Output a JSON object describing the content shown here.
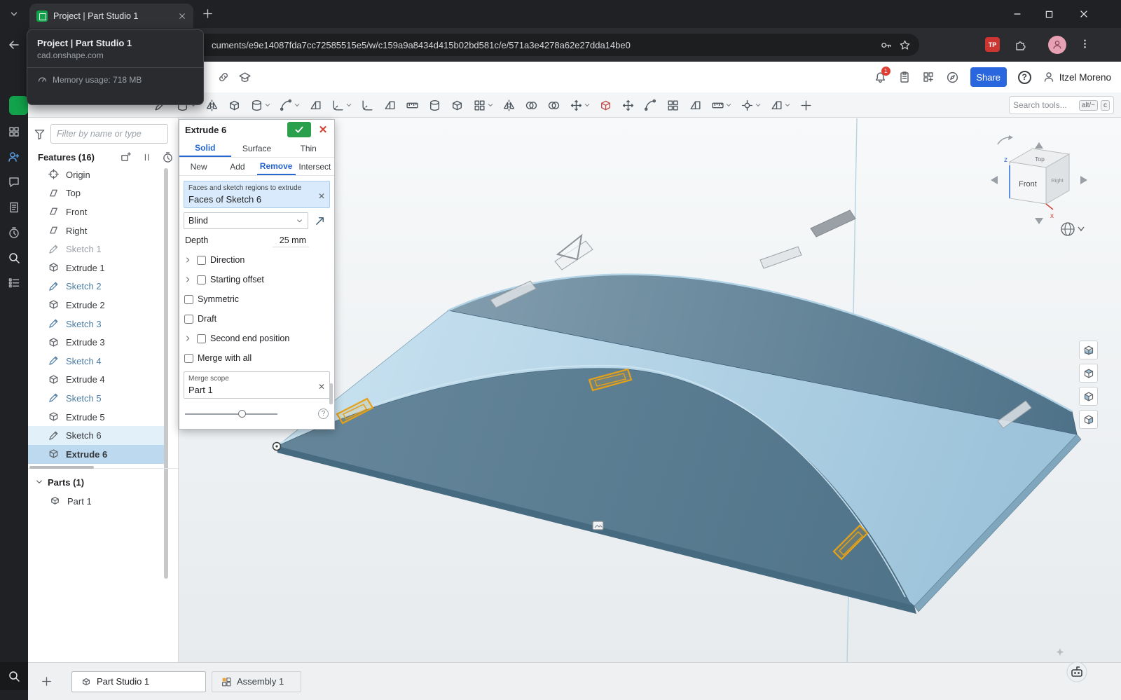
{
  "browser": {
    "tab_title": "Project | Part Studio 1",
    "url": "cuments/e9e14087fda7cc72585515e5/w/c159a9a8434d415b02bd581c/e/571a3e4278a62e27dda14be0",
    "tp_badge": "TP",
    "hovercard": {
      "title": "Project | Part Studio 1",
      "domain": "cad.onshape.com",
      "memory_label": "Memory usage: 718 MB"
    }
  },
  "rail": {
    "icons": [
      {
        "name": "apps-grid-icon",
        "glyph": "grid",
        "color": "#a9adb2"
      },
      {
        "name": "add-person-icon",
        "glyph": "personadd",
        "color": "#5aa2e8"
      },
      {
        "name": "chat-icon",
        "glyph": "chat",
        "color": "#a9adb2"
      },
      {
        "name": "notes-icon",
        "glyph": "note",
        "color": "#a9adb2"
      },
      {
        "name": "history-icon",
        "glyph": "clock",
        "color": "#a9adb2"
      },
      {
        "name": "search-icon",
        "glyph": "search",
        "color": "#e4e6e8"
      },
      {
        "name": "tasks-icon",
        "glyph": "tasks",
        "color": "#a9adb2"
      }
    ]
  },
  "header": {
    "notification_count": "1",
    "share_label": "Share",
    "help_label": "?",
    "user_name": "Itzel Moreno"
  },
  "toolbar": {
    "search_placeholder": "Search tools...",
    "shortcut_keys": [
      "alt/~",
      "c"
    ],
    "tools": [
      {
        "name": "sketch-icon",
        "glyph": "pen",
        "dropdown": false
      },
      {
        "name": "circle-icon",
        "glyph": "cyl",
        "dropdown": true
      },
      {
        "name": "mirror-sketch-icon",
        "glyph": "mir",
        "dropdown": false
      },
      {
        "name": "extrude-icon",
        "glyph": "box",
        "dropdown": false
      },
      {
        "name": "revolve-icon",
        "glyph": "cyl",
        "dropdown": true
      },
      {
        "name": "sweep-icon",
        "glyph": "arc",
        "dropdown": true
      },
      {
        "name": "loft-icon",
        "glyph": "she",
        "dropdown": false
      },
      {
        "name": "fillet-icon",
        "glyph": "fil",
        "dropdown": true
      },
      {
        "name": "chamfer-icon",
        "glyph": "fil",
        "dropdown": false
      },
      {
        "name": "draft-icon",
        "glyph": "she",
        "dropdown": false
      },
      {
        "name": "rib-icon",
        "glyph": "rul",
        "dropdown": false
      },
      {
        "name": "hole-icon",
        "glyph": "cyl",
        "dropdown": false
      },
      {
        "name": "shell-icon",
        "glyph": "box",
        "dropdown": false
      },
      {
        "name": "linear-pattern-icon",
        "glyph": "grid",
        "dropdown": true
      },
      {
        "name": "mirror-pattern-icon",
        "glyph": "mir",
        "dropdown": false
      },
      {
        "name": "boolean-icon",
        "glyph": "ven",
        "dropdown": false
      },
      {
        "name": "split-icon",
        "glyph": "ven",
        "dropdown": false
      },
      {
        "name": "transform-icon",
        "glyph": "mov",
        "dropdown": true
      },
      {
        "name": "delete-face-icon",
        "glyph": "box",
        "dropdown": false
      },
      {
        "name": "move-face-icon",
        "glyph": "mov",
        "dropdown": false
      },
      {
        "name": "offset-surface-icon",
        "glyph": "arc",
        "dropdown": false
      },
      {
        "name": "boundary-surface-icon",
        "glyph": "grid",
        "dropdown": false
      },
      {
        "name": "fill-surface-icon",
        "glyph": "she",
        "dropdown": false
      },
      {
        "name": "measure-icon",
        "glyph": "rul",
        "dropdown": true
      },
      {
        "name": "mate-connector-icon",
        "glyph": "con",
        "dropdown": true
      },
      {
        "name": "sheet-metal-icon",
        "glyph": "she",
        "dropdown": true
      },
      {
        "name": "custom-feature-icon",
        "glyph": "plu",
        "dropdown": false
      }
    ]
  },
  "sidebar": {
    "filter_placeholder": "Filter by name or type",
    "features_header": "Features (16)",
    "tree": [
      {
        "label": "Origin",
        "type": "origin",
        "state": "normal"
      },
      {
        "label": "Top",
        "type": "plane",
        "state": "normal"
      },
      {
        "label": "Front",
        "type": "plane",
        "state": "normal"
      },
      {
        "label": "Right",
        "type": "plane",
        "state": "normal"
      },
      {
        "label": "Sketch 1",
        "type": "sketch",
        "state": "muted"
      },
      {
        "label": "Extrude 1",
        "type": "extrude",
        "state": "normal"
      },
      {
        "label": "Sketch 2",
        "type": "sketch",
        "state": "blue"
      },
      {
        "label": "Extrude 2",
        "type": "extrude",
        "state": "normal"
      },
      {
        "label": "Sketch 3",
        "type": "sketch",
        "state": "blue"
      },
      {
        "label": "Extrude 3",
        "type": "extrude",
        "state": "normal"
      },
      {
        "label": "Sketch 4",
        "type": "sketch",
        "state": "blue"
      },
      {
        "label": "Extrude 4",
        "type": "extrude",
        "state": "normal"
      },
      {
        "label": "Sketch 5",
        "type": "sketch",
        "state": "blue"
      },
      {
        "label": "Extrude 5",
        "type": "extrude",
        "state": "normal"
      },
      {
        "label": "Sketch 6",
        "type": "sketch",
        "state": "hover"
      },
      {
        "label": "Extrude 6",
        "type": "extrude",
        "state": "selected"
      }
    ],
    "parts_header": "Parts (1)",
    "parts": [
      {
        "label": "Part 1",
        "type": "part"
      }
    ]
  },
  "dialog": {
    "title": "Extrude 6",
    "tabs_primary": [
      "Solid",
      "Surface",
      "Thin"
    ],
    "tabs_primary_active": "Solid",
    "tabs_secondary": [
      "New",
      "Add",
      "Remove",
      "Intersect"
    ],
    "tabs_secondary_active": "Remove",
    "selection_label": "Faces and sketch regions to extrude",
    "selection_value": "Faces of Sketch 6",
    "end_type": "Blind",
    "depth_label": "Depth",
    "depth_value": "25 mm",
    "options": [
      {
        "label": "Direction",
        "expandable": true,
        "checked": false
      },
      {
        "label": "Starting offset",
        "expandable": true,
        "checked": false
      },
      {
        "label": "Symmetric",
        "expandable": false,
        "checked": false
      },
      {
        "label": "Draft",
        "expandable": false,
        "checked": false
      },
      {
        "label": "Second end position",
        "expandable": true,
        "checked": false
      },
      {
        "label": "Merge with all",
        "expandable": false,
        "checked": false
      }
    ],
    "merge_scope_label": "Merge scope",
    "merge_scope_value": "Part 1"
  },
  "viewport": {
    "view_cube": {
      "front": "Front",
      "top": "Top",
      "right": "Right"
    },
    "axes": {
      "z": "z",
      "x": "x"
    },
    "view_buttons": [
      "section-view-button",
      "view-cube-home-button",
      "standard-views-button",
      "camera-options-button"
    ]
  },
  "bottom_bar": {
    "tabs": [
      {
        "label": "Part Studio 1",
        "active": true,
        "icon": "part-studio-icon"
      },
      {
        "label": "Assembly 1",
        "active": false,
        "icon": "assembly-icon"
      }
    ]
  },
  "colors": {
    "accent_blue": "#2566d1",
    "share_blue": "#2a66dd",
    "confirm_green": "#2ba04c",
    "cancel_red": "#d23f31",
    "selection_bg": "#d8eafb",
    "highlight_orange": "#e5a117",
    "model_top": "#5c7f94",
    "model_deck": "#b5d6e8",
    "model_front": "#5b7e93"
  }
}
